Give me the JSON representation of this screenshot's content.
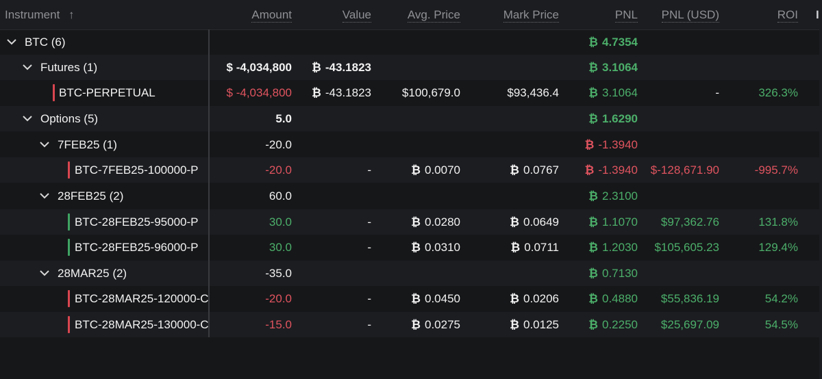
{
  "headers": {
    "instrument": "Instrument",
    "sort_arrow": "↑",
    "amount": "Amount",
    "value": "Value",
    "avg_price": "Avg. Price",
    "mark_price": "Mark Price",
    "pnl": "PNL",
    "pnl_usd": "PNL (USD)",
    "roi": "ROI",
    "extra": "I"
  },
  "btc_symbol": "₿",
  "colors": {
    "green": "#4caf6a",
    "red": "#e0545f",
    "bg": "#161719"
  },
  "rows": [
    {
      "instrument": "BTC (6)",
      "amount": "",
      "value": "",
      "avg_price": "",
      "mark_price": "",
      "pnl": "4.7354",
      "pnl_usd": "",
      "roi": ""
    },
    {
      "instrument": "Futures (1)",
      "amount": "$ -4,034,800",
      "value": "-43.1823",
      "avg_price": "",
      "mark_price": "",
      "pnl": "3.1064",
      "pnl_usd": "",
      "roi": ""
    },
    {
      "instrument": "BTC-PERPETUAL",
      "amount": "$ -4,034,800",
      "value": "-43.1823",
      "avg_price": "$100,679.0",
      "mark_price": "$93,436.4",
      "pnl": "3.1064",
      "pnl_usd": "-",
      "roi": "326.3%"
    },
    {
      "instrument": "Options (5)",
      "amount": "5.0",
      "value": "",
      "avg_price": "",
      "mark_price": "",
      "pnl": "1.6290",
      "pnl_usd": "",
      "roi": ""
    },
    {
      "instrument": "7FEB25 (1)",
      "amount": "-20.0",
      "value": "",
      "avg_price": "",
      "mark_price": "",
      "pnl": "-1.3940",
      "pnl_usd": "",
      "roi": ""
    },
    {
      "instrument": "BTC-7FEB25-100000-P",
      "amount": "-20.0",
      "value": "-",
      "avg_price": "0.0070",
      "mark_price": "0.0767",
      "pnl": "-1.3940",
      "pnl_usd": "$-128,671.90",
      "roi": "-995.7%"
    },
    {
      "instrument": "28FEB25 (2)",
      "amount": "60.0",
      "value": "",
      "avg_price": "",
      "mark_price": "",
      "pnl": "2.3100",
      "pnl_usd": "",
      "roi": ""
    },
    {
      "instrument": "BTC-28FEB25-95000-P",
      "amount": "30.0",
      "value": "-",
      "avg_price": "0.0280",
      "mark_price": "0.0649",
      "pnl": "1.1070",
      "pnl_usd": "$97,362.76",
      "roi": "131.8%"
    },
    {
      "instrument": "BTC-28FEB25-96000-P",
      "amount": "30.0",
      "value": "-",
      "avg_price": "0.0310",
      "mark_price": "0.0711",
      "pnl": "1.2030",
      "pnl_usd": "$105,605.23",
      "roi": "129.4%"
    },
    {
      "instrument": "28MAR25 (2)",
      "amount": "-35.0",
      "value": "",
      "avg_price": "",
      "mark_price": "",
      "pnl": "0.7130",
      "pnl_usd": "",
      "roi": ""
    },
    {
      "instrument": "BTC-28MAR25-120000-C",
      "amount": "-20.0",
      "value": "-",
      "avg_price": "0.0450",
      "mark_price": "0.0206",
      "pnl": "0.4880",
      "pnl_usd": "$55,836.19",
      "roi": "54.2%"
    },
    {
      "instrument": "BTC-28MAR25-130000-C",
      "amount": "-15.0",
      "value": "-",
      "avg_price": "0.0275",
      "mark_price": "0.0125",
      "pnl": "0.2250",
      "pnl_usd": "$25,697.09",
      "roi": "54.5%"
    }
  ]
}
